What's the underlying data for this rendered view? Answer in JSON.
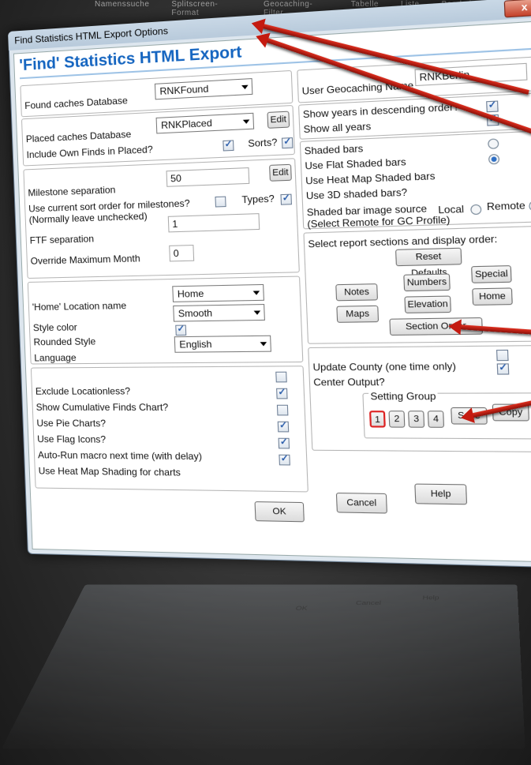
{
  "background_bar": [
    "Namenssuche",
    "Splitscreen-Format",
    "Geocaching-Filter",
    "Tabelle",
    "Liste",
    "Bearbeiten"
  ],
  "window": {
    "title": "Find Statistics HTML Export Options",
    "close_label": "x",
    "header": "'Find' Statistics HTML Export"
  },
  "found": {
    "label": "Found caches Database",
    "value": "RNKFound"
  },
  "placed": {
    "label": "Placed caches Database",
    "value": "RNKPlaced",
    "edit_label": "Edit",
    "own_finds_label": "Include Own Finds in Placed?",
    "sorts_label": "Sorts?"
  },
  "milestone": {
    "label": "Milestone separation",
    "value": "50",
    "edit_label": "Edit",
    "sort_label": "Use current sort order for milestones?",
    "sort_note": "(Normally leave unchecked)",
    "types_label": "Types?",
    "ftf_label": "FTF separation",
    "ftf_value": "1",
    "max_month_label": "Override Maximum Month",
    "max_month_value": "0"
  },
  "location": {
    "home_label": "'Home' Location name",
    "home_value": "Home",
    "style_label": "Style color",
    "style_value": "Smooth",
    "rounded_label": "Rounded Style",
    "language_label": "Language",
    "language_value": "English"
  },
  "options": {
    "exclude": "Exclude Locationless?",
    "cumulative": "Show Cumulative Finds Chart?",
    "pie": "Use Pie Charts?",
    "flag": "Use Flag Icons?",
    "autorun": "Auto-Run macro next time (with delay)",
    "heatmap": "Use Heat Map Shading for charts"
  },
  "user": {
    "label": "User Geocaching Name",
    "value": "RNKBerlin"
  },
  "years": {
    "descending": "Show years in descending order?",
    "all": "Show all years"
  },
  "bars": {
    "shaded": "Shaded bars",
    "flat": "Use Flat Shaded bars",
    "heatmap": "Use Heat Map Shaded bars",
    "three_d": "Use 3D shaded bars?",
    "source_label": "Shaded bar image source",
    "source_note": "(Select Remote for GC Profile)",
    "local": "Local",
    "remote": "Remote"
  },
  "sections": {
    "label": "Select report sections and display order:",
    "reset": "Reset Defaults",
    "notes": "Notes",
    "numbers": "Numbers",
    "special": "Special",
    "maps": "Maps",
    "elevation": "Elevation",
    "home": "Home",
    "order": "Section Order"
  },
  "misc": {
    "county": "Update County (one time only)",
    "center": "Center Output?"
  },
  "setting": {
    "label": "Setting Group",
    "groups": [
      "1",
      "2",
      "3",
      "4"
    ],
    "save": "Save",
    "copy": "Copy"
  },
  "footer": {
    "ok": "OK",
    "cancel": "Cancel",
    "help": "Help"
  },
  "colors": {
    "header": "#1565c0",
    "arrow": "#c41a10",
    "selected_group": "#dd2222"
  }
}
